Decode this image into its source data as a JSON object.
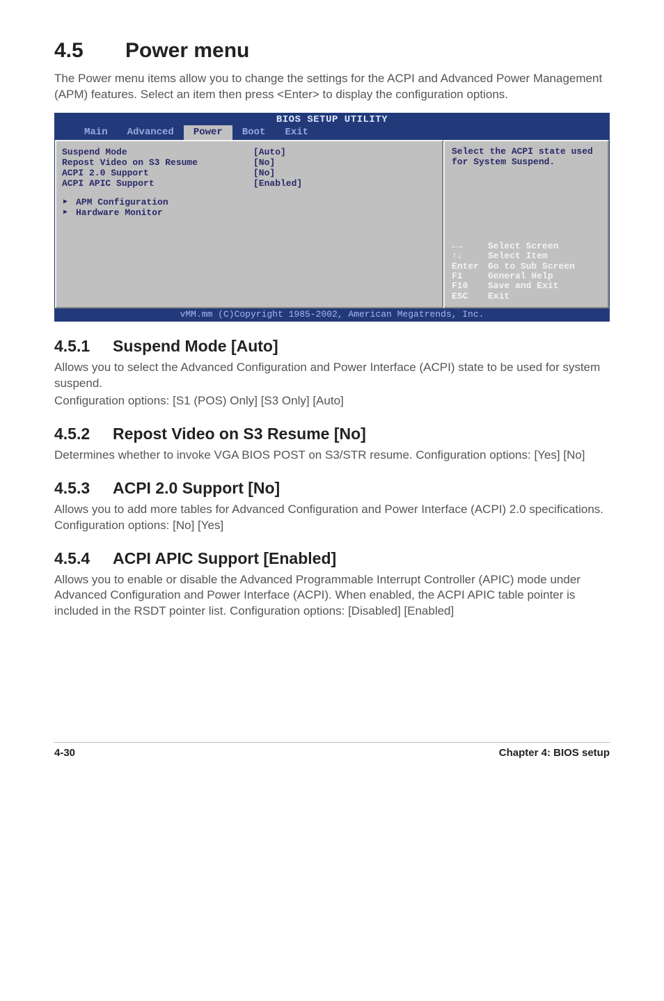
{
  "title_num": "4.5",
  "title_text": "Power menu",
  "intro": "The Power menu items allow you to change the settings for the ACPI and Advanced Power Management (APM) features. Select an item then press <Enter> to display the configuration options.",
  "bios": {
    "title": "BIOS SETUP UTILITY",
    "tabs": [
      "Main",
      "Advanced",
      "Power",
      "Boot",
      "Exit"
    ],
    "items": [
      {
        "label": "Suspend Mode",
        "value": "[Auto]"
      },
      {
        "label": "Repost Video on S3 Resume",
        "value": "[No]"
      },
      {
        "label": "ACPI 2.0 Support",
        "value": "[No]"
      },
      {
        "label": "ACPI APIC Support",
        "value": "[Enabled]"
      }
    ],
    "subitems": [
      {
        "label": "APM Configuration"
      },
      {
        "label": "Hardware Monitor"
      }
    ],
    "help_top": "Select the ACPI state used for System Suspend.",
    "help_rows": [
      {
        "k": "←→",
        "d": "Select Screen"
      },
      {
        "k": "↑↓",
        "d": "Select Item"
      },
      {
        "k": "Enter",
        "d": "Go to Sub Screen"
      },
      {
        "k": "F1",
        "d": "General Help"
      },
      {
        "k": "F10",
        "d": "Save and Exit"
      },
      {
        "k": "ESC",
        "d": "Exit"
      }
    ],
    "footer": "vMM.mm (C)Copyright 1985-2002, American Megatrends, Inc."
  },
  "sections": [
    {
      "num": "4.5.1",
      "title": "Suspend Mode [Auto]",
      "paras": [
        "Allows you to select the Advanced Configuration and Power Interface (ACPI) state to be used for system suspend.",
        "Configuration options: [S1 (POS) Only] [S3 Only] [Auto]"
      ]
    },
    {
      "num": "4.5.2",
      "title": "Repost Video on S3 Resume [No]",
      "paras": [
        "Determines whether to invoke VGA BIOS POST on S3/STR resume. Configuration options: [Yes] [No]"
      ]
    },
    {
      "num": "4.5.3",
      "title": "ACPI 2.0 Support [No]",
      "paras": [
        "Allows you to add more tables for Advanced Configuration and Power Interface (ACPI) 2.0 specifications. Configuration options: [No] [Yes]"
      ]
    },
    {
      "num": "4.5.4",
      "title": "ACPI APIC Support [Enabled]",
      "paras": [
        "Allows you to enable or disable the Advanced Programmable Interrupt Controller (APIC) mode under Advanced Configuration and Power Interface (ACPI). When enabled, the ACPI APIC table pointer is included in the RSDT pointer list. Configuration options: [Disabled] [Enabled]"
      ]
    }
  ],
  "footer": {
    "left": "4-30",
    "right": "Chapter 4: BIOS setup"
  }
}
